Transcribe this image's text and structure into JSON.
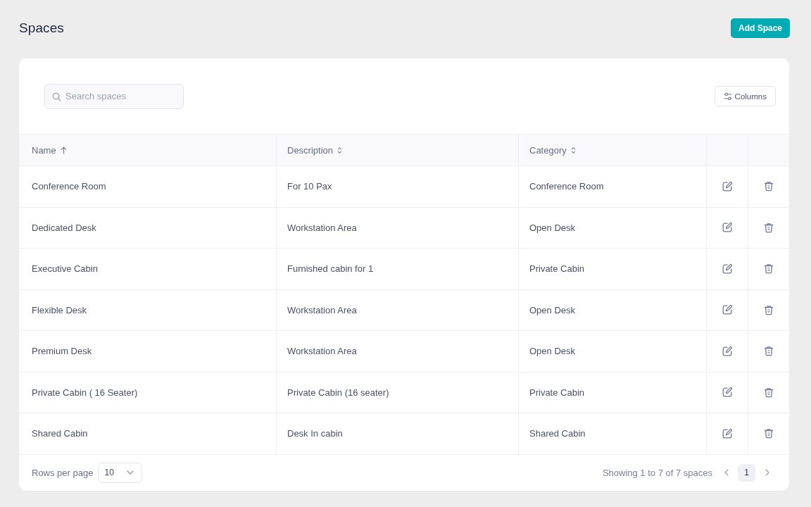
{
  "page": {
    "title": "Spaces",
    "add_button": "Add Space"
  },
  "toolbar": {
    "search": {
      "placeholder": "Search spaces"
    },
    "columns_button": "Columns"
  },
  "table": {
    "columns": [
      {
        "label": "Name",
        "sorted": true
      },
      {
        "label": "Description",
        "sorted": false
      },
      {
        "label": "Category",
        "sorted": false
      }
    ],
    "rows": [
      {
        "name": "Conference Room",
        "description": "For 10 Pax",
        "category": "Conference Room"
      },
      {
        "name": "Dedicated Desk",
        "description": "Workstation Area",
        "category": "Open Desk"
      },
      {
        "name": "Executive Cabin",
        "description": "Furnished cabin for 1",
        "category": "Private Cabin"
      },
      {
        "name": "Flexible Desk",
        "description": "Workstation Area",
        "category": "Open Desk"
      },
      {
        "name": "Premium Desk",
        "description": "Workstation Area",
        "category": "Open Desk"
      },
      {
        "name": "Private Cabin ( 16 Seater)",
        "description": "Private Cabin (16 seater)",
        "category": "Private Cabin"
      },
      {
        "name": "Shared Cabin",
        "description": "Desk In cabin",
        "category": "Shared Cabin"
      }
    ]
  },
  "footer": {
    "rows_per_page": {
      "label": "Rows per page",
      "value": "10"
    },
    "summary": "Showing 1 to 7 of 7 spaces",
    "pages": [
      {
        "label": "1",
        "selected": true
      }
    ]
  }
}
